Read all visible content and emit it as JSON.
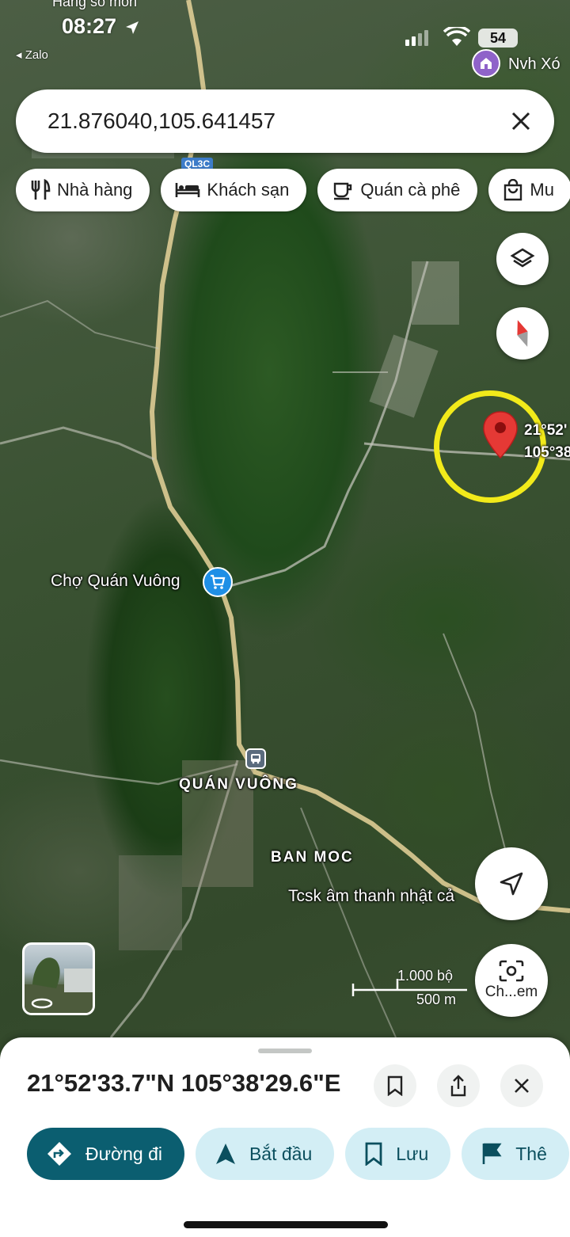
{
  "status_bar": {
    "time": "08:27",
    "back_app": "◂ Zalo",
    "top_partial_text": "Hàng số môn",
    "battery": "54"
  },
  "search": {
    "value": "21.876040,105.641457"
  },
  "chips": [
    {
      "label": "Nhà hàng",
      "icon": "fork-knife-icon"
    },
    {
      "label": "Khách sạn",
      "icon": "bed-icon"
    },
    {
      "label": "Quán cà phê",
      "icon": "coffee-icon"
    },
    {
      "label": "Mu",
      "icon": "shopping-bag-icon"
    }
  ],
  "map": {
    "road_shield": "QL3C",
    "poi_top_right": "Nvh Xó",
    "marker_label_line1": "21°52'",
    "marker_label_line2": "105°38",
    "labels": {
      "market": "Chợ Quán Vuông",
      "town": "QUÁN VUÔNG",
      "village": "BAN MOC",
      "business": "Tcsk âm thanh nhật cả"
    },
    "scale_top": "1.000 bộ",
    "scale_bottom": "500 m",
    "camera_button_label": "Ch...em"
  },
  "sheet": {
    "title": "21°52'33.7\"N 105°38'29.6\"E",
    "actions": [
      {
        "label": "Đường đi",
        "icon": "directions-icon"
      },
      {
        "label": "Bắt đầu",
        "icon": "navigation-arrow-icon"
      },
      {
        "label": "Lưu",
        "icon": "bookmark-icon"
      },
      {
        "label": "Thê",
        "icon": "flag-icon"
      }
    ]
  },
  "colors": {
    "highlight_circle": "#f2ea1a",
    "marker": "#e53935",
    "primary_action": "#0b5e70",
    "secondary_action": "#d3eef5"
  }
}
